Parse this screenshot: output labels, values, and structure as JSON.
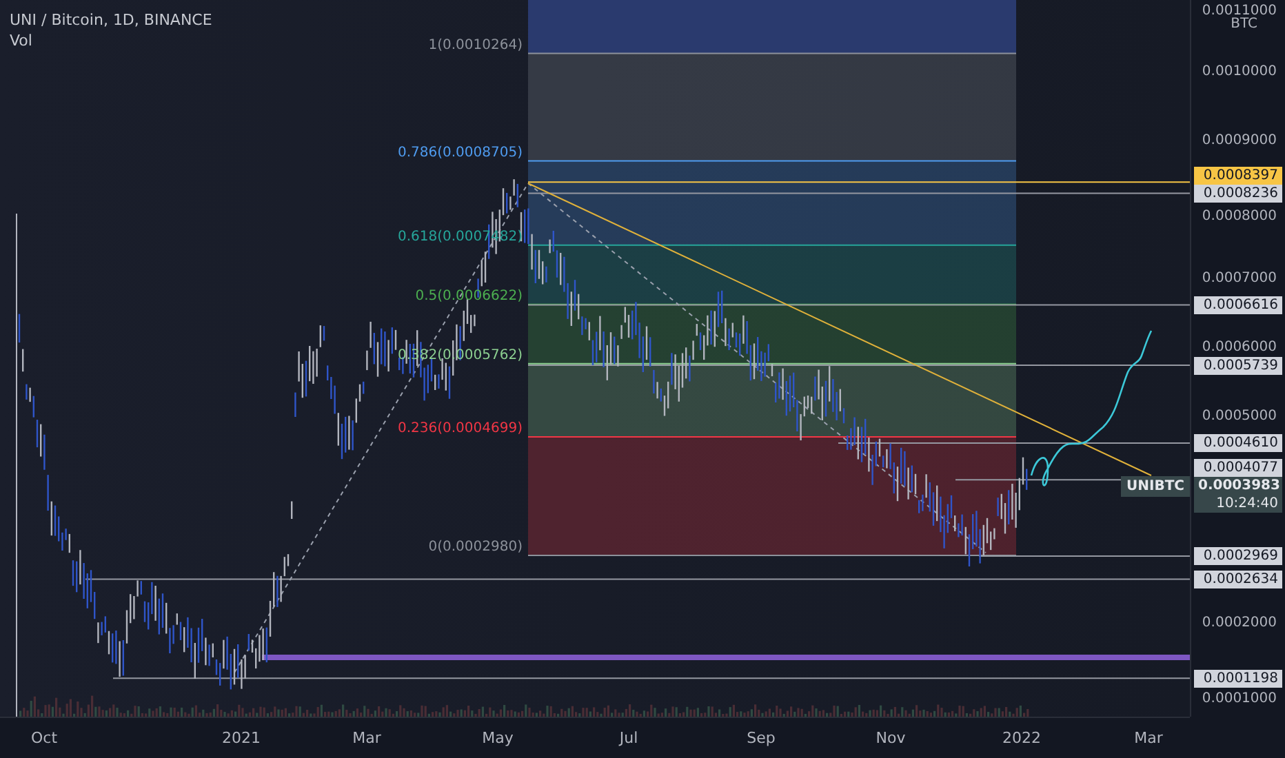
{
  "legend": {
    "title": "UNI / Bitcoin, 1D, BINANCE",
    "indicator": "Vol"
  },
  "fib_levels": [
    {
      "label": "1(0.0010264)",
      "color": "#8d929b"
    },
    {
      "label": "0.786(0.0008705)",
      "color": "#4f9cf0"
    },
    {
      "label": "0.618(0.0007482)",
      "color": "#26a69a"
    },
    {
      "label": "0.5(0.0006622)",
      "color": "#4caf50"
    },
    {
      "label": "0.382(0.0005762)",
      "color": "#8ccf90"
    },
    {
      "label": "0.236(0.0004699)",
      "color": "#f23645"
    },
    {
      "label": "0(0.0002980)",
      "color": "#8d929b"
    }
  ],
  "price_axis": {
    "unit": "BTC",
    "ticks": [
      "0.0011000",
      "0.0010000",
      "0.0009000",
      "0.0008000",
      "0.0007000",
      "0.0006000",
      "0.0005000",
      "0.0002000",
      "0.0001000"
    ]
  },
  "price_tags": [
    {
      "kind": "highlight",
      "value": "0.0008397"
    },
    {
      "kind": "plain",
      "value": "0.0008236"
    },
    {
      "kind": "plain",
      "value": "0.0006616"
    },
    {
      "kind": "plain",
      "value": "0.0005739"
    },
    {
      "kind": "plain",
      "value": "0.0004610"
    },
    {
      "kind": "plain",
      "value": "0.0004077"
    },
    {
      "kind": "symbol",
      "symbol": "UNIBTC",
      "value": "0.0003983",
      "countdown": "10:24:40"
    },
    {
      "kind": "plain",
      "value": "0.0002969"
    },
    {
      "kind": "plain",
      "value": "0.0002634"
    },
    {
      "kind": "plain",
      "value": "0.0001198"
    }
  ],
  "time_axis": [
    "Oct",
    "2021",
    "Mar",
    "May",
    "Jul",
    "Sep",
    "Nov",
    "2022",
    "Mar"
  ]
}
